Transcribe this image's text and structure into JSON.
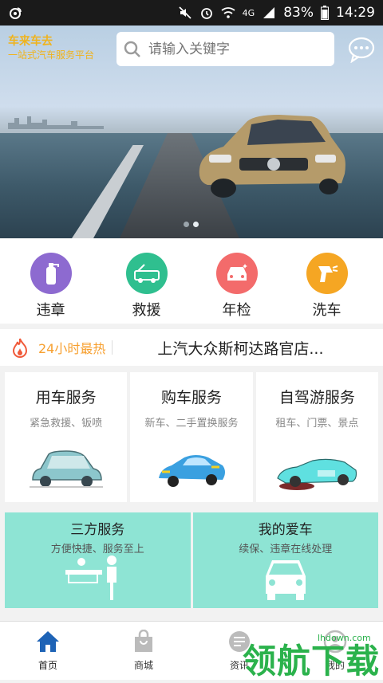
{
  "status_bar": {
    "carrier_icon": "weibo-icon",
    "network": "4G",
    "battery": "83%",
    "time": "14:29"
  },
  "brand": {
    "name": "车来车去",
    "slogan": "一站式汽车服务平台"
  },
  "search": {
    "placeholder": "请输入关键字"
  },
  "quick_services": [
    {
      "label": "违章",
      "icon": "extinguisher-icon",
      "color": "#8d6ad0"
    },
    {
      "label": "救援",
      "icon": "tow-truck-icon",
      "color": "#2fbf8f"
    },
    {
      "label": "年检",
      "icon": "car-check-icon",
      "color": "#f36b6b"
    },
    {
      "label": "洗车",
      "icon": "spray-gun-icon",
      "color": "#f5a623"
    }
  ],
  "hot": {
    "tag": "24小时最热",
    "headline": "上汽大众斯柯达路官店..."
  },
  "service_cards": [
    {
      "title": "用车服务",
      "subtitle": "紧急救援、钣喷"
    },
    {
      "title": "购车服务",
      "subtitle": "新车、二手置换服务"
    },
    {
      "title": "自驾游服务",
      "subtitle": "租车、门票、景点"
    }
  ],
  "tiles": [
    {
      "title": "三方服务",
      "subtitle": "方便快捷、服务至上"
    },
    {
      "title": "我的爱车",
      "subtitle": "续保、违章在线处理"
    }
  ],
  "nav": [
    {
      "label": "首页",
      "icon": "home-icon",
      "active": true
    },
    {
      "label": "商城",
      "icon": "shopping-bag-icon",
      "active": false
    },
    {
      "label": "资讯",
      "icon": "news-icon",
      "active": false
    },
    {
      "label": "我的",
      "icon": "profile-icon",
      "active": false
    }
  ],
  "watermark": {
    "text": "领航下载",
    "url": "lhdown.com"
  }
}
